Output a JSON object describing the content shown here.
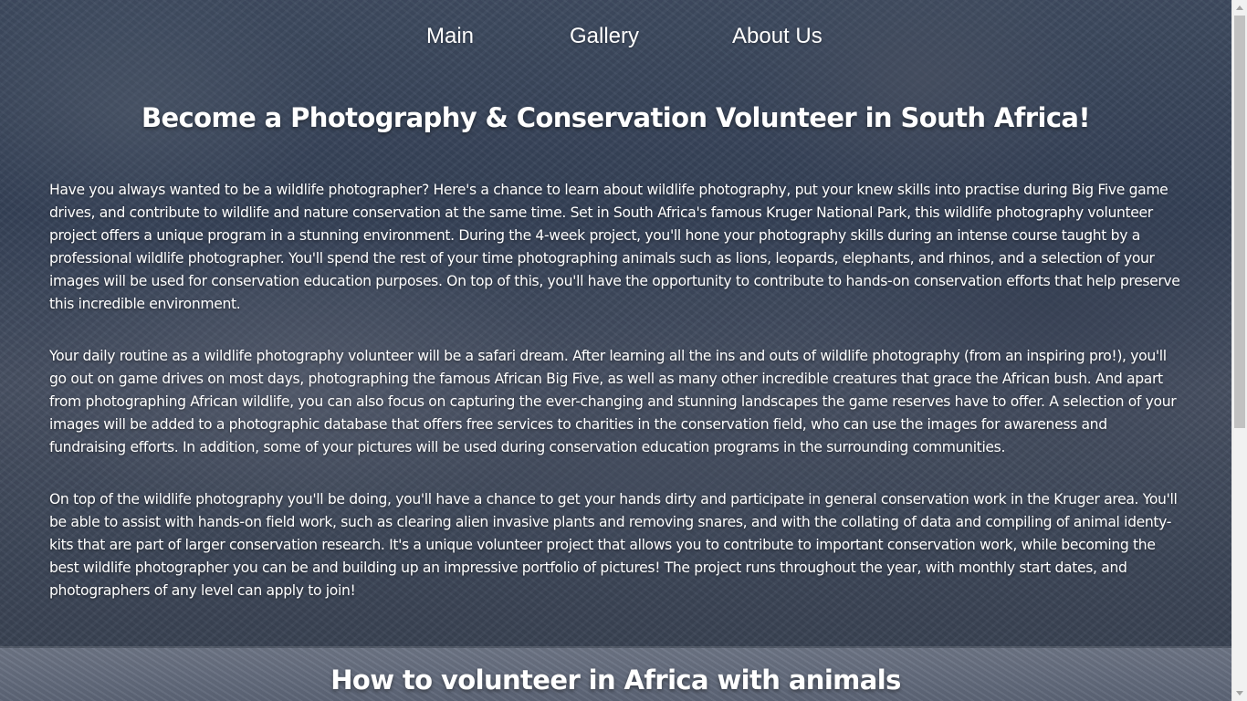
{
  "nav": {
    "items": [
      {
        "label": "Main"
      },
      {
        "label": "Gallery"
      },
      {
        "label": "About Us"
      }
    ]
  },
  "hero": {
    "title": "Become a Photography & Conservation Volunteer in South Africa!"
  },
  "paragraphs": [
    "Have you always wanted to be a wildlife photographer? Here's a chance to learn about wildlife photography, put your knew skills into practise during Big Five game drives, and contribute to wildlife and nature conservation at the same time. Set in South Africa's famous Kruger National Park, this wildlife photography volunteer project offers a unique program in a stunning environment. During the 4-week project, you'll hone your photography skills during an intense course taught by a professional wildlife photographer. You'll spend the rest of your time photographing animals such as lions, leopards, elephants, and rhinos, and a selection of your images will be used for conservation education purposes. On top of this, you'll have the opportunity to contribute to hands-on conservation efforts that help preserve this incredible environment.",
    "Your daily routine as a wildlife photography volunteer will be a safari dream. After learning all the ins and outs of wildlife photography (from an inspiring pro!), you'll go out on game drives on most days, photographing the famous African Big Five, as well as many other incredible creatures that grace the African bush. And apart from photographing African wildlife, you can also focus on capturing the ever-changing and stunning landscapes the game reserves have to offer. A selection of your images will be added to a photographic database that offers free services to charities in the conservation field, who can use the images for awareness and fundraising efforts. In addition, some of your pictures will be used during conservation education programs in the surrounding communities.",
    "On top of the wildlife photography you'll be doing, you'll have a chance to get your hands dirty and participate in general conservation work in the Kruger area. You'll be able to assist with hands-on field work, such as clearing alien invasive plants and removing snares, and with the collating of data and compiling of animal identy-kits that are part of larger conservation research. It's a unique volunteer project that allows you to contribute to important conservation work, while becoming the best wildlife photographer you can be and building up an impressive portfolio of pictures! The project runs throughout the year, with monthly start dates, and photographers of any level can apply to join!"
  ],
  "section2": {
    "title": "How to volunteer in Africa with animals"
  },
  "colors": {
    "text": "#ffffff",
    "scrollbar_track": "#f1f1f1",
    "scrollbar_thumb": "#c1c1c1"
  }
}
